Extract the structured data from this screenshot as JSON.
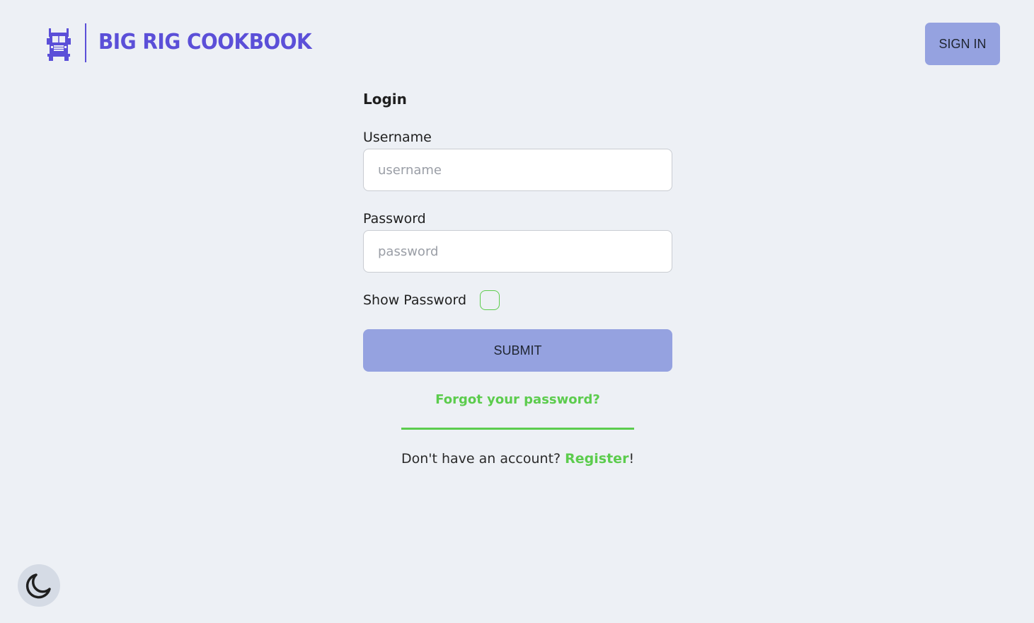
{
  "header": {
    "brand": "BIG RIG COOKBOOK",
    "signin_label": "SIGN IN",
    "logo_icon": "truck-icon"
  },
  "login": {
    "title": "Login",
    "username_label": "Username",
    "username_placeholder": "username",
    "username_value": "",
    "password_label": "Password",
    "password_placeholder": "password",
    "password_value": "",
    "show_password_label": "Show Password",
    "show_password_checked": false,
    "submit_label": "SUBMIT",
    "forgot_label": "Forgot your password?",
    "no_account_text": "Don't have an account? ",
    "register_label": "Register",
    "register_suffix": "!"
  },
  "theme_toggle": {
    "icon": "moon-icon"
  },
  "colors": {
    "brand": "#5b4fd8",
    "button": "#95a2e0",
    "accent_green": "#5ccc4d",
    "background": "#edf0f5"
  }
}
